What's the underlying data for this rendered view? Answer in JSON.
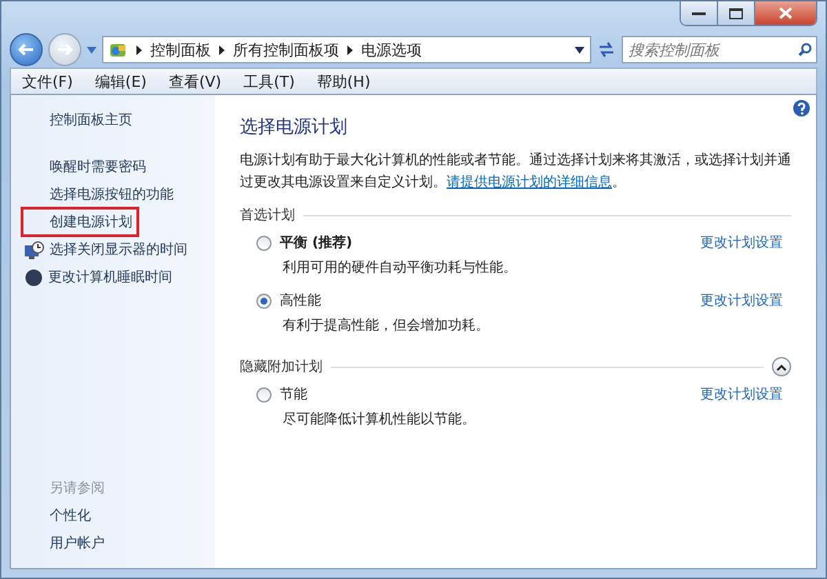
{
  "address_bar": {
    "breadcrumbs": [
      "控制面板",
      "所有控制面板项",
      "电源选项"
    ]
  },
  "search": {
    "placeholder": "搜索控制面板"
  },
  "menu": [
    "文件(F)",
    "编辑(E)",
    "查看(V)",
    "工具(T)",
    "帮助(H)"
  ],
  "sidebar": {
    "home": "控制面板主页",
    "items": [
      {
        "label": "唤醒时需要密码",
        "kind": "link",
        "highlighted": false
      },
      {
        "label": "选择电源按钮的功能",
        "kind": "link",
        "highlighted": false
      },
      {
        "label": "创建电源计划",
        "kind": "link",
        "highlighted": true
      },
      {
        "label": "选择关闭显示器的时间",
        "kind": "monitor",
        "highlighted": false
      },
      {
        "label": "更改计算机睡眠时间",
        "kind": "sleep",
        "highlighted": false
      }
    ],
    "see_also": {
      "title": "另请参阅",
      "items": [
        "个性化",
        "用户帐户"
      ]
    }
  },
  "main": {
    "title": "选择电源计划",
    "intro": "电源计划有助于最大化计算机的性能或者节能。通过选择计划来将其激活，或选择计划并通过更改其电源设置来自定义计划。",
    "intro_link": "请提供电源计划的详细信息",
    "intro_end": "。",
    "sections": [
      {
        "title": "首选计划",
        "plans": [
          {
            "name": "平衡 (推荐)",
            "recommended": true,
            "selected": false,
            "description": "利用可用的硬件自动平衡功耗与性能。",
            "link": "更改计划设置"
          },
          {
            "name": "高性能",
            "recommended": false,
            "selected": true,
            "description": "有利于提高性能，但会增加功耗。",
            "link": "更改计划设置"
          }
        ]
      },
      {
        "title": "隐藏附加计划",
        "expanded": true,
        "plans": [
          {
            "name": "节能",
            "recommended": false,
            "selected": false,
            "description": "尽可能降低计算机性能以节能。",
            "link": "更改计划设置"
          }
        ]
      }
    ]
  }
}
